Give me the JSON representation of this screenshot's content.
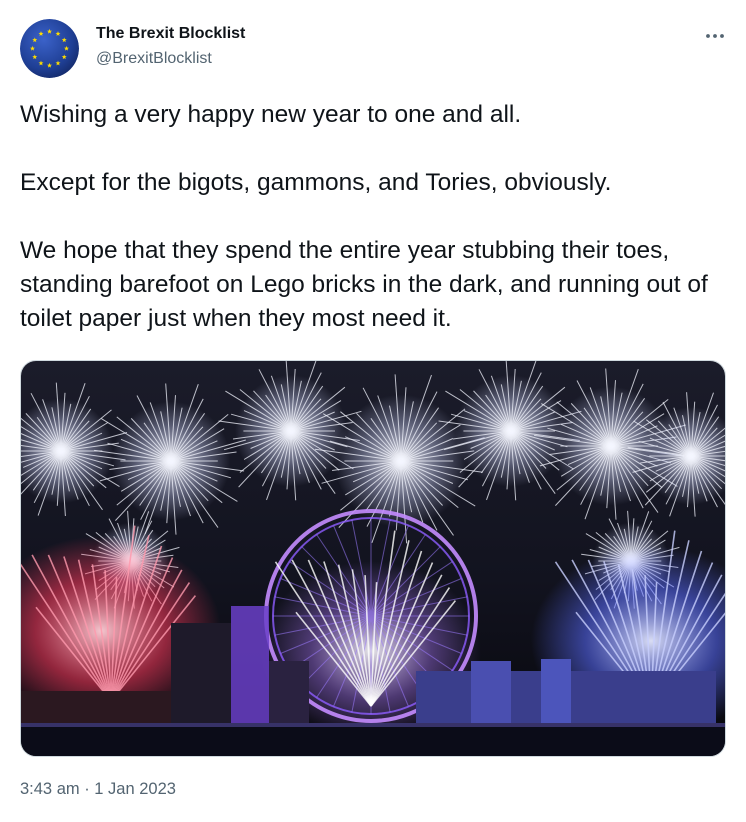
{
  "author": {
    "display_name": "The Brexit Blocklist",
    "handle": "@BrexitBlocklist",
    "avatar_icon": "eu-flag-icon"
  },
  "tweet": {
    "paragraphs": [
      "Wishing a very happy new year to one and all.",
      "Except for the bigots, gammons, and Tories, obviously.",
      "We hope that they spend the entire year stubbing their toes, standing barefoot on Lego bricks in the dark, and running out of toilet paper just when they most need it."
    ],
    "timestamp": "3:43 am · 1 Jan 2023"
  },
  "media": {
    "description_icon": "fireworks-photo"
  },
  "colors": {
    "text_primary": "#0f1419",
    "text_secondary": "#536471",
    "eu_blue": "#1f3f95",
    "eu_star": "#ffdd00",
    "border": "#cfd9de"
  }
}
